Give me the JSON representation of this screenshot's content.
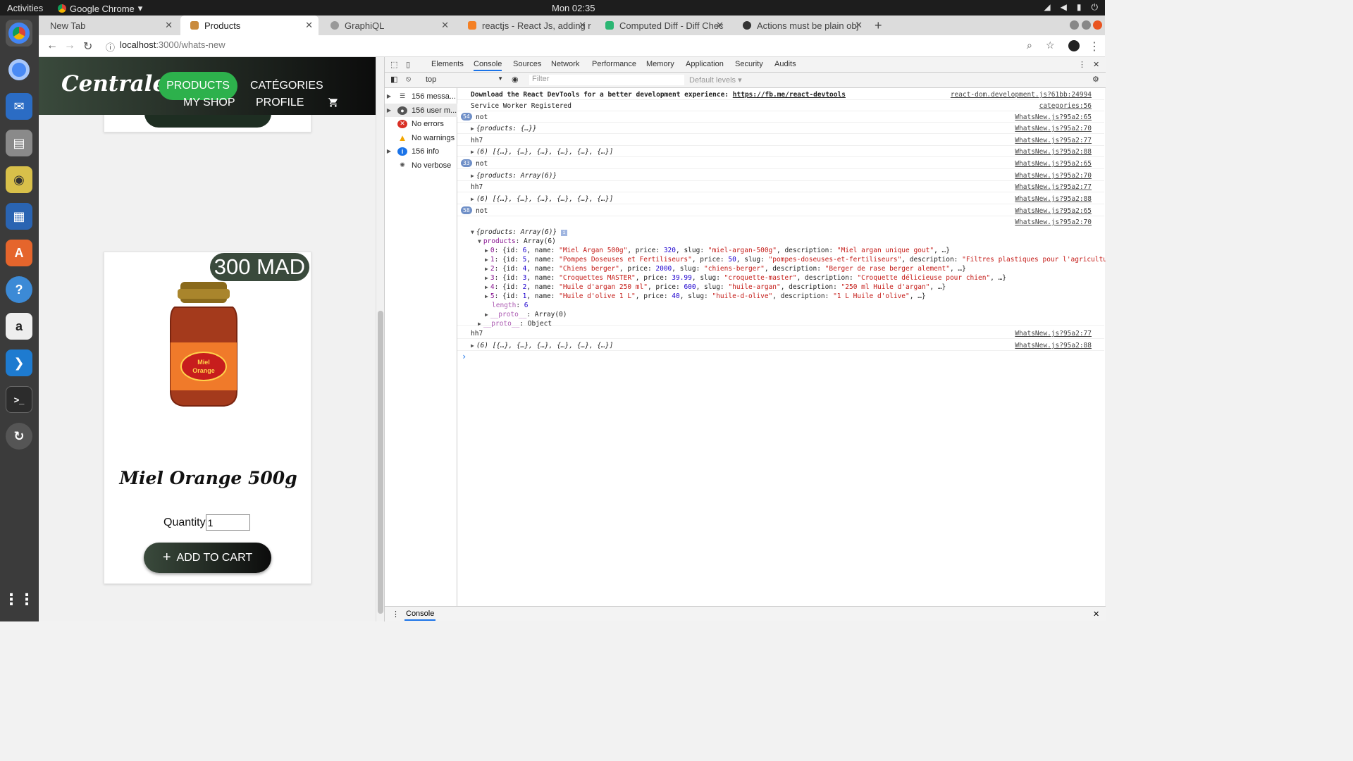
{
  "system": {
    "activities": "Activities",
    "app_name": "Google Chrome",
    "clock": "Mon 02:35"
  },
  "browser": {
    "tabs": [
      {
        "title": "New Tab"
      },
      {
        "title": "Products"
      },
      {
        "title": "GraphiQL"
      },
      {
        "title": "reactjs - React Js, adding r"
      },
      {
        "title": "Computed Diff - Diff Chec"
      },
      {
        "title": "Actions must be plain obj"
      }
    ],
    "url_host": "localhost",
    "url_path": ":3000/whats-new"
  },
  "page": {
    "logo": "Centrale",
    "nav": {
      "products": "PRODUCTS",
      "categories": "CATÉGORIES",
      "my_shop": "MY SHOP",
      "profile": "PROFILE"
    },
    "product": {
      "price": "300 MAD",
      "jar_label_1": "Miel",
      "jar_label_2": "Orange",
      "name": "Miel Orange 500g",
      "quantity_label": "Quantity",
      "quantity_value": "1",
      "add_to_cart": "ADD TO CART"
    }
  },
  "devtools": {
    "tabs": [
      "Elements",
      "Console",
      "Sources",
      "Network",
      "Performance",
      "Memory",
      "Application",
      "Security",
      "Audits"
    ],
    "context": "top",
    "filter_placeholder": "Filter",
    "levels": "Default levels",
    "sidebar": {
      "messages": "156 messa...",
      "user_messages": "156 user m...",
      "errors": "No errors",
      "warnings": "No warnings",
      "info": "156 info",
      "verbose": "No verbose"
    },
    "console": {
      "lines": [
        {
          "text": "Download the React DevTools for a better development experience: ",
          "link": "https://fb.me/react-devtools",
          "src": "react-dom.development.js?61bb:24994",
          "count": ""
        },
        {
          "text": "Service Worker Registered",
          "src": "categories:56",
          "count": ""
        },
        {
          "text": "not",
          "src": "WhatsNew.js?95a2:65",
          "count": "54"
        },
        {
          "text": "{products: {…}}",
          "src": "WhatsNew.js?95a2:70",
          "count": ""
        },
        {
          "text": "hh7",
          "src": "WhatsNew.js?95a2:77",
          "count": ""
        },
        {
          "text": "(6) [{…}, {…}, {…}, {…}, {…}, {…}]",
          "src": "WhatsNew.js?95a2:88",
          "count": ""
        },
        {
          "text": "not",
          "src": "WhatsNew.js?95a2:65",
          "count": "33"
        },
        {
          "text": "{products: Array(6)}",
          "src": "WhatsNew.js?95a2:70",
          "count": ""
        },
        {
          "text": "hh7",
          "src": "WhatsNew.js?95a2:77",
          "count": ""
        },
        {
          "text": "(6) [{…}, {…}, {…}, {…}, {…}, {…}]",
          "src": "WhatsNew.js?95a2:88",
          "count": ""
        },
        {
          "text": "not",
          "src": "WhatsNew.js?95a2:65",
          "count": "58"
        },
        {
          "text": "",
          "src": "WhatsNew.js?95a2:70",
          "count": ""
        }
      ],
      "expanded": {
        "head": "{products: Array(6)}",
        "products_key": "products",
        "products_val": "Array(6)",
        "items": [
          {
            "idx": "0",
            "id": "6",
            "name": "\"Miel Argan 500g\"",
            "price": "320",
            "slug": "\"miel-argan-500g\"",
            "desc": "\"Miel argan unique gout\"",
            "tail": ", …}"
          },
          {
            "idx": "1",
            "id": "5",
            "name": "\"Pompes Doseuses et Fertiliseurs\"",
            "price": "50",
            "slug": "\"pompes-doseuses-et-fertiliseurs\"",
            "desc": "\"Filtres plastiques pour l'agriculture,…",
            "tail": ""
          },
          {
            "idx": "2",
            "id": "4",
            "name": "\"Chiens berger\"",
            "price": "2000",
            "slug": "\"chiens-berger\"",
            "desc": "\"Berger de rase berger alement\"",
            "tail": ", …}"
          },
          {
            "idx": "3",
            "id": "3",
            "name": "\"Croquettes MASTER\"",
            "price": "39.99",
            "slug": "\"croquette-master\"",
            "desc": "\"Croquette délicieuse pour chien\"",
            "tail": ", …}"
          },
          {
            "idx": "4",
            "id": "2",
            "name": "\"Huile d'argan 250 ml\"",
            "price": "600",
            "slug": "\"huile-argan\"",
            "desc": "\"250 ml Huile d'argan\"",
            "tail": ", …}"
          },
          {
            "idx": "5",
            "id": "1",
            "name": "\"Huile d'olive 1 L\"",
            "price": "40",
            "slug": "\"huile-d-olive\"",
            "desc": "\"1 L Huile d'olive\"",
            "tail": ", …}"
          }
        ],
        "length_key": "length",
        "length_val": "6",
        "proto_array": "__proto__",
        "proto_array_val": ": Array(0)",
        "proto_obj": "__proto__",
        "proto_obj_val": ": Object"
      },
      "after": [
        {
          "text": "hh7",
          "src": "WhatsNew.js?95a2:77"
        },
        {
          "text": "(6) [{…}, {…}, {…}, {…}, {…}, {…}]",
          "src": "WhatsNew.js?95a2:88"
        }
      ],
      "prompt": "›"
    },
    "drawer_tab": "Console"
  }
}
